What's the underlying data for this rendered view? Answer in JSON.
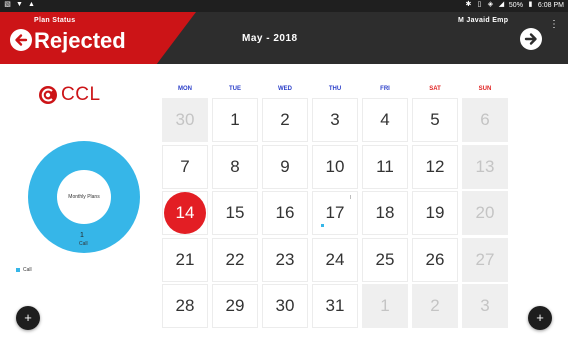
{
  "status_bar": {
    "battery": "50%",
    "time": "6:08 PM"
  },
  "header": {
    "plan_status_label": "Plan Status",
    "status_value": "Rejected",
    "month_title": "May - 2018",
    "user_name": "M Javaid Emp"
  },
  "logo": {
    "text": "CCL"
  },
  "summary": {
    "center_label": "Monthly Plans",
    "value": "1",
    "value_label": "Call",
    "legend": "Call",
    "color": "#36b6e8"
  },
  "calendar": {
    "weekdays": [
      "MON",
      "TUE",
      "WED",
      "THU",
      "FRI",
      "SAT",
      "SUN"
    ],
    "weeks": [
      [
        "30",
        "1",
        "2",
        "3",
        "4",
        "5",
        "6"
      ],
      [
        "7",
        "8",
        "9",
        "10",
        "11",
        "12",
        "13"
      ],
      [
        "14",
        "15",
        "16",
        "17",
        "18",
        "19",
        "20"
      ],
      [
        "21",
        "22",
        "23",
        "24",
        "25",
        "26",
        "27"
      ],
      [
        "28",
        "29",
        "30",
        "31",
        "1",
        "2",
        "3"
      ]
    ],
    "today": "14",
    "weekday_color": "#2b3fc9",
    "weekend_color": "#e02020",
    "today_color": "#e31e24"
  },
  "actions": {
    "add_label": "+"
  }
}
